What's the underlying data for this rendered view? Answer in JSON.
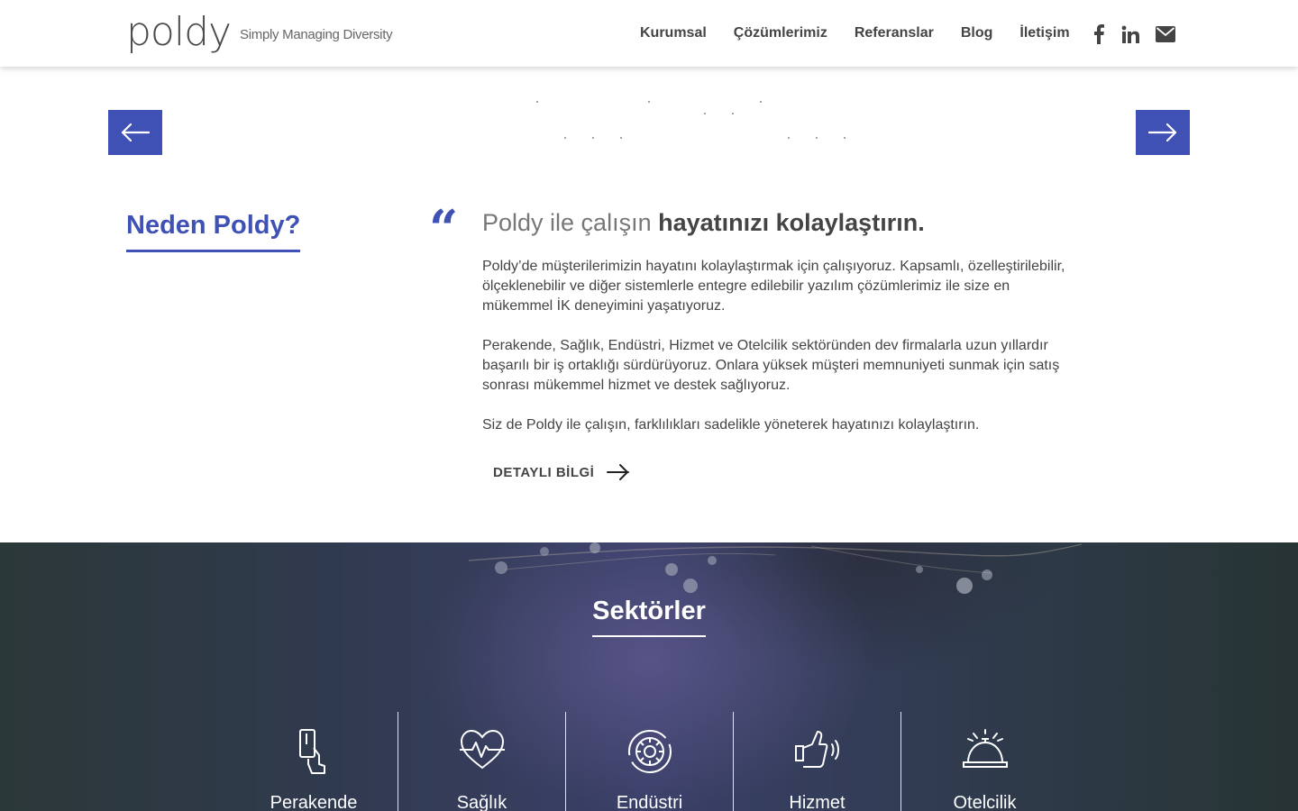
{
  "brand": {
    "name": "poldy",
    "tagline": "Simply Managing Diversity"
  },
  "nav": [
    {
      "label": "Kurumsal"
    },
    {
      "label": "Çözümlerimiz"
    },
    {
      "label": "Referanslar"
    },
    {
      "label": "Blog"
    },
    {
      "label": "İletişim"
    }
  ],
  "social": [
    {
      "icon": "facebook-icon"
    },
    {
      "icon": "linkedin-icon"
    },
    {
      "icon": "envelope-icon"
    }
  ],
  "why": {
    "title": "Neden Poldy?",
    "lead_light": "Poldy ile çalışın ",
    "lead_strong": "hayatınızı kolaylaştırın.",
    "paragraphs": [
      "Poldy’de müşterilerimizin hayatını kolaylaştırmak için çalışıyoruz. Kapsamlı, özelleştirilebilir, ölçeklenebilir ve diğer sistemlerle entegre edilebilir yazılım çözümlerimiz ile size en mükemmel İK deneyimini yaşatıyoruz.",
      "Perakende, Sağlık, Endüstri, Hizmet ve Otelcilik sektöründen dev firmalarla uzun yıllardır başarılı bir iş ortaklığı sürdürüyoruz. Onlara yüksek müşteri memnuniyeti sunmak için satış sonrası mükemmel hizmet ve destek sağlıyoruz.",
      "Siz de Poldy ile çalışın, farklılıkları sadelikle yöneterek hayatınızı kolaylaştırın."
    ],
    "cta": "DETAYLI BİLGİ"
  },
  "sectors": {
    "title": "Sektörler",
    "items": [
      {
        "label": "Perakende",
        "icon": "card-hand-icon"
      },
      {
        "label": "Sağlık",
        "icon": "heartbeat-icon"
      },
      {
        "label": "Endüstri",
        "icon": "gear-icon"
      },
      {
        "label": "Hizmet",
        "icon": "thumbs-up-icon"
      },
      {
        "label": "Otelcilik",
        "icon": "service-bell-icon"
      }
    ]
  },
  "colors": {
    "accent": "#3f51b5",
    "text": "#444444"
  }
}
